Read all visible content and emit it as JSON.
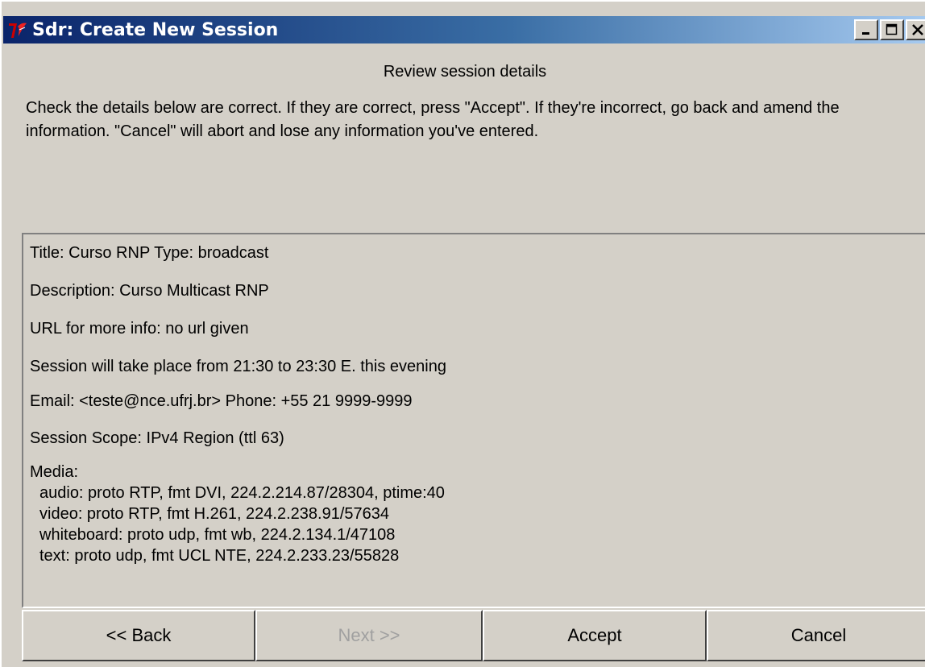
{
  "window": {
    "title": "Sdr: Create New Session",
    "controls": [
      "minimize",
      "maximize",
      "close"
    ]
  },
  "dialog": {
    "heading": "Review session details",
    "instructions": "Check the details below are correct.  If they are correct, press \"Accept\".  If they're incorrect, go back and amend the information.  \"Cancel\" will abort and lose any information you've entered."
  },
  "details": {
    "title_line": "Title:  Curso RNP  Type:  broadcast",
    "description_line": "Description:  Curso Multicast RNP",
    "url_line": "URL for more info:  no url given",
    "schedule_line": "Session will take place from 21:30 to 23:30 E. this evening",
    "contact_line": "Email:   <teste@nce.ufrj.br>  Phone:   +55 21 9999-9999",
    "scope_line": "Session Scope:  IPv4 Region (ttl 63)",
    "media_label": "Media:",
    "media": [
      "audio: proto RTP, fmt DVI, 224.2.214.87/28304, ptime:40",
      "video: proto RTP, fmt H.261, 224.2.238.91/57634",
      "whiteboard: proto udp, fmt wb, 224.2.134.1/47108",
      "text: proto udp, fmt UCL NTE, 224.2.233.23/55828"
    ]
  },
  "buttons": {
    "back": "<< Back",
    "next": "Next >>",
    "accept": "Accept",
    "cancel": "Cancel"
  },
  "colors": {
    "titlebar_start": "#0a246a",
    "titlebar_end": "#a6caf0",
    "face": "#d4d0c8",
    "disabled_text": "#a0a0a0",
    "tk_icon": "#c00000"
  }
}
